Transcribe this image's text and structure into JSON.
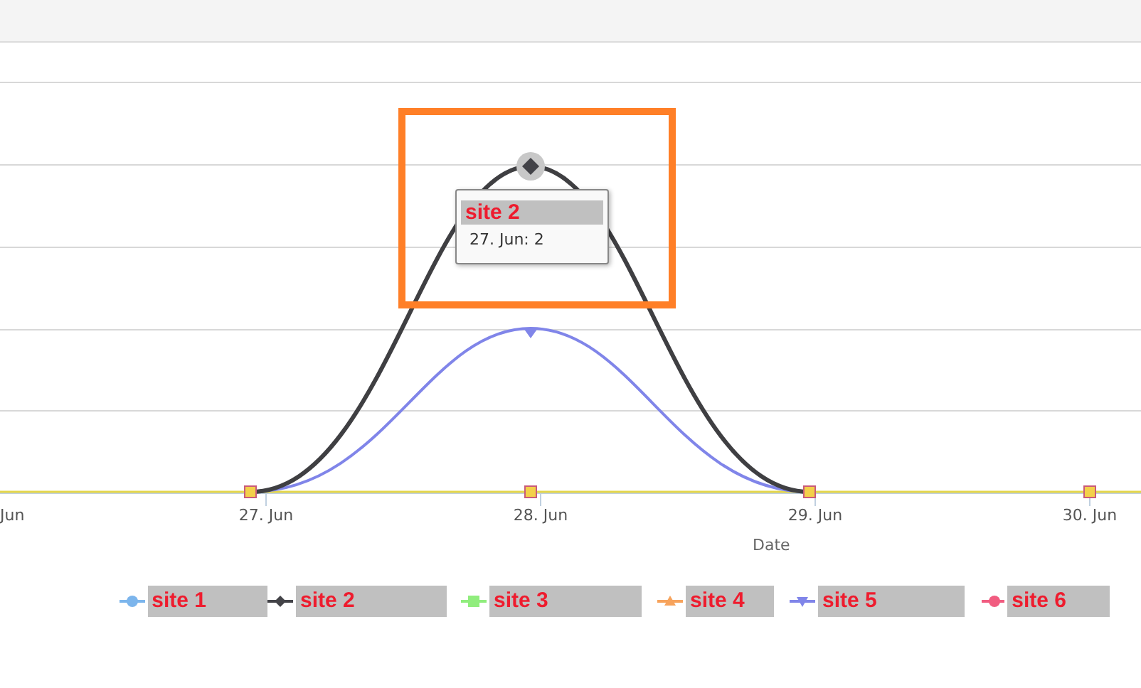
{
  "chart": {
    "x_labels": [
      "Jun",
      "27. Jun",
      "28. Jun",
      "29. Jun",
      "30. Jun"
    ],
    "x_title": "Date",
    "tooltip": {
      "series": "site 2",
      "text": "27. Jun: 2"
    }
  },
  "legend": [
    {
      "label": "site 1",
      "color": "#7cb5ec",
      "kind": "circle"
    },
    {
      "label": "site 2",
      "color": "#434348",
      "kind": "diamond"
    },
    {
      "label": "site 3",
      "color": "#90ed7d",
      "kind": "square"
    },
    {
      "label": "site 4",
      "color": "#f7a35c",
      "kind": "triangle"
    },
    {
      "label": "site 5",
      "color": "#8085e9",
      "kind": "triangle-down"
    },
    {
      "label": "site 6",
      "color": "#f15c80",
      "kind": "circle"
    }
  ]
}
